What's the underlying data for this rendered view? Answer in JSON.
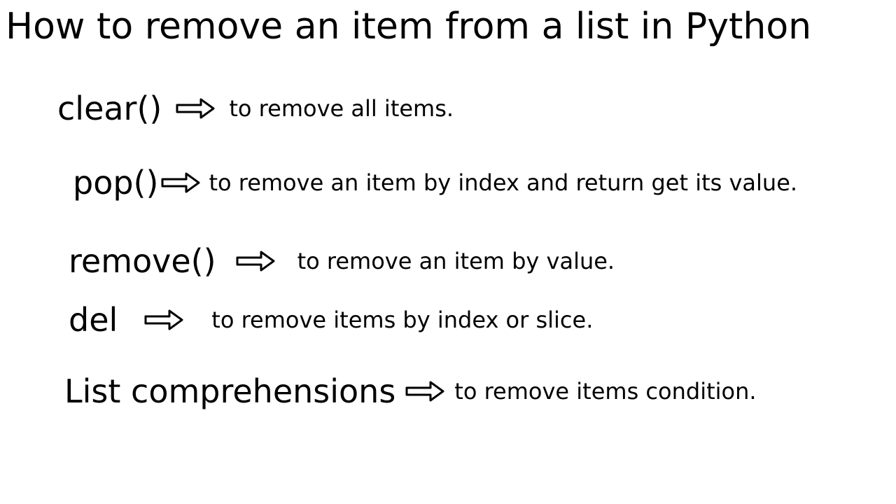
{
  "title": "How to remove an item from a list in Python",
  "items": [
    {
      "method": "clear()",
      "desc": "to remove all items."
    },
    {
      "method": "pop()",
      "desc": "to remove an item by index and return get its value."
    },
    {
      "method": "remove()",
      "desc": "to remove an item by value."
    },
    {
      "method": "del",
      "desc": "to remove items by index or slice."
    },
    {
      "method": "List comprehensions",
      "desc": "to remove items condition."
    }
  ]
}
